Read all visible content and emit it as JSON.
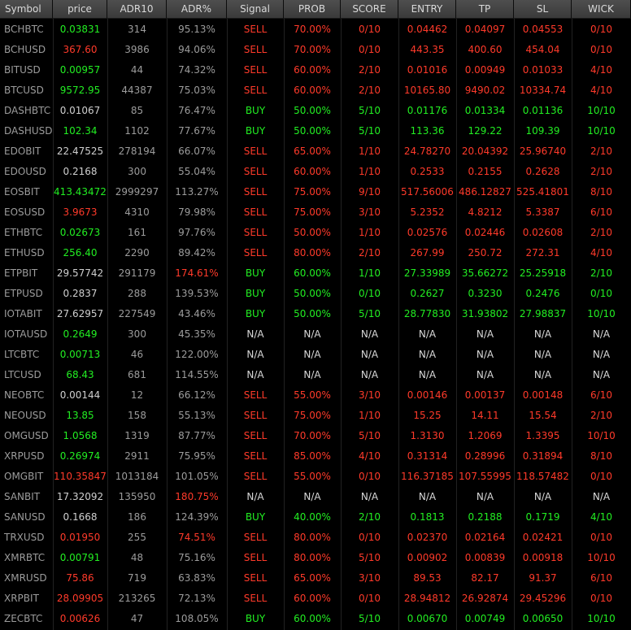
{
  "colors": {
    "neutral": "#cfcfcf",
    "green": "#22ee22",
    "red": "#ff3a2a",
    "na": "#d8d8d8",
    "dim": "#9c9c9c"
  },
  "headers": [
    "Symbol",
    "price",
    "ADR10",
    "ADR%",
    "Signal",
    "PROB",
    "SCORE",
    "ENTRY",
    "TP",
    "SL",
    "WICK"
  ],
  "rows": [
    {
      "symbol": "BCHBTC",
      "price": "0.03831",
      "price_c": "green",
      "adr10": "314",
      "adrp": "95.13%",
      "adrp_c": "dim",
      "signal": "SELL",
      "prob": "70.00%",
      "score": "0/10",
      "entry": "0.04462",
      "tp": "0.04097",
      "sl": "0.04553",
      "wick": "0/10"
    },
    {
      "symbol": "BCHUSD",
      "price": "367.60",
      "price_c": "red",
      "adr10": "3986",
      "adrp": "94.06%",
      "adrp_c": "dim",
      "signal": "SELL",
      "prob": "70.00%",
      "score": "0/10",
      "entry": "443.35",
      "tp": "400.60",
      "sl": "454.04",
      "wick": "0/10"
    },
    {
      "symbol": "BITUSD",
      "price": "0.00957",
      "price_c": "green",
      "adr10": "44",
      "adrp": "74.32%",
      "adrp_c": "dim",
      "signal": "SELL",
      "prob": "60.00%",
      "score": "2/10",
      "entry": "0.01016",
      "tp": "0.00949",
      "sl": "0.01033",
      "wick": "4/10"
    },
    {
      "symbol": "BTCUSD",
      "price": "9572.95",
      "price_c": "green",
      "adr10": "44387",
      "adrp": "75.03%",
      "adrp_c": "dim",
      "signal": "SELL",
      "prob": "60.00%",
      "score": "2/10",
      "entry": "10165.80",
      "tp": "9490.02",
      "sl": "10334.74",
      "wick": "4/10"
    },
    {
      "symbol": "DASHBTC",
      "price": "0.01067",
      "price_c": "neutral",
      "adr10": "85",
      "adrp": "76.47%",
      "adrp_c": "dim",
      "signal": "BUY",
      "prob": "50.00%",
      "score": "5/10",
      "entry": "0.01176",
      "tp": "0.01334",
      "sl": "0.01136",
      "wick": "10/10"
    },
    {
      "symbol": "DASHUSD",
      "price": "102.34",
      "price_c": "green",
      "adr10": "1102",
      "adrp": "77.67%",
      "adrp_c": "dim",
      "signal": "BUY",
      "prob": "50.00%",
      "score": "5/10",
      "entry": "113.36",
      "tp": "129.22",
      "sl": "109.39",
      "wick": "10/10"
    },
    {
      "symbol": "EDOBIT",
      "price": "22.47525",
      "price_c": "neutral",
      "adr10": "278194",
      "adrp": "66.07%",
      "adrp_c": "dim",
      "signal": "SELL",
      "prob": "65.00%",
      "score": "1/10",
      "entry": "24.78270",
      "tp": "20.04392",
      "sl": "25.96740",
      "wick": "2/10"
    },
    {
      "symbol": "EDOUSD",
      "price": "0.2168",
      "price_c": "neutral",
      "adr10": "300",
      "adrp": "55.04%",
      "adrp_c": "dim",
      "signal": "SELL",
      "prob": "60.00%",
      "score": "1/10",
      "entry": "0.2533",
      "tp": "0.2155",
      "sl": "0.2628",
      "wick": "2/10"
    },
    {
      "symbol": "EOSBIT",
      "price": "413.43472",
      "price_c": "green",
      "adr10": "2999297",
      "adrp": "113.27%",
      "adrp_c": "dim",
      "signal": "SELL",
      "prob": "75.00%",
      "score": "9/10",
      "entry": "517.56006",
      "tp": "486.12827",
      "sl": "525.41801",
      "wick": "8/10"
    },
    {
      "symbol": "EOSUSD",
      "price": "3.9673",
      "price_c": "red",
      "adr10": "4310",
      "adrp": "79.98%",
      "adrp_c": "dim",
      "signal": "SELL",
      "prob": "75.00%",
      "score": "3/10",
      "entry": "5.2352",
      "tp": "4.8212",
      "sl": "5.3387",
      "wick": "6/10"
    },
    {
      "symbol": "ETHBTC",
      "price": "0.02673",
      "price_c": "green",
      "adr10": "161",
      "adrp": "97.76%",
      "adrp_c": "dim",
      "signal": "SELL",
      "prob": "50.00%",
      "score": "1/10",
      "entry": "0.02576",
      "tp": "0.02446",
      "sl": "0.02608",
      "wick": "2/10"
    },
    {
      "symbol": "ETHUSD",
      "price": "256.40",
      "price_c": "green",
      "adr10": "2290",
      "adrp": "89.42%",
      "adrp_c": "dim",
      "signal": "SELL",
      "prob": "80.00%",
      "score": "2/10",
      "entry": "267.99",
      "tp": "250.72",
      "sl": "272.31",
      "wick": "4/10"
    },
    {
      "symbol": "ETPBIT",
      "price": "29.57742",
      "price_c": "neutral",
      "adr10": "291179",
      "adrp": "174.61%",
      "adrp_c": "red",
      "signal": "BUY",
      "prob": "60.00%",
      "score": "1/10",
      "entry": "27.33989",
      "tp": "35.66272",
      "sl": "25.25918",
      "wick": "2/10"
    },
    {
      "symbol": "ETPUSD",
      "price": "0.2837",
      "price_c": "neutral",
      "adr10": "288",
      "adrp": "139.53%",
      "adrp_c": "dim",
      "signal": "BUY",
      "prob": "50.00%",
      "score": "0/10",
      "entry": "0.2627",
      "tp": "0.3230",
      "sl": "0.2476",
      "wick": "0/10"
    },
    {
      "symbol": "IOTABIT",
      "price": "27.62957",
      "price_c": "neutral",
      "adr10": "227549",
      "adrp": "43.46%",
      "adrp_c": "dim",
      "signal": "BUY",
      "prob": "50.00%",
      "score": "5/10",
      "entry": "28.77830",
      "tp": "31.93802",
      "sl": "27.98837",
      "wick": "10/10"
    },
    {
      "symbol": "IOTAUSD",
      "price": "0.2649",
      "price_c": "green",
      "adr10": "300",
      "adrp": "45.35%",
      "adrp_c": "dim",
      "signal": "N/A",
      "prob": "N/A",
      "score": "N/A",
      "entry": "N/A",
      "tp": "N/A",
      "sl": "N/A",
      "wick": "N/A"
    },
    {
      "symbol": "LTCBTC",
      "price": "0.00713",
      "price_c": "green",
      "adr10": "46",
      "adrp": "122.00%",
      "adrp_c": "dim",
      "signal": "N/A",
      "prob": "N/A",
      "score": "N/A",
      "entry": "N/A",
      "tp": "N/A",
      "sl": "N/A",
      "wick": "N/A"
    },
    {
      "symbol": "LTCUSD",
      "price": "68.43",
      "price_c": "green",
      "adr10": "681",
      "adrp": "114.55%",
      "adrp_c": "dim",
      "signal": "N/A",
      "prob": "N/A",
      "score": "N/A",
      "entry": "N/A",
      "tp": "N/A",
      "sl": "N/A",
      "wick": "N/A"
    },
    {
      "symbol": "NEOBTC",
      "price": "0.00144",
      "price_c": "neutral",
      "adr10": "12",
      "adrp": "66.12%",
      "adrp_c": "dim",
      "signal": "SELL",
      "prob": "55.00%",
      "score": "3/10",
      "entry": "0.00146",
      "tp": "0.00137",
      "sl": "0.00148",
      "wick": "6/10"
    },
    {
      "symbol": "NEOUSD",
      "price": "13.85",
      "price_c": "green",
      "adr10": "158",
      "adrp": "55.13%",
      "adrp_c": "dim",
      "signal": "SELL",
      "prob": "75.00%",
      "score": "1/10",
      "entry": "15.25",
      "tp": "14.11",
      "sl": "15.54",
      "wick": "2/10"
    },
    {
      "symbol": "OMGUSD",
      "price": "1.0568",
      "price_c": "green",
      "adr10": "1319",
      "adrp": "87.77%",
      "adrp_c": "dim",
      "signal": "SELL",
      "prob": "70.00%",
      "score": "5/10",
      "entry": "1.3130",
      "tp": "1.2069",
      "sl": "1.3395",
      "wick": "10/10"
    },
    {
      "symbol": "XRPUSD",
      "price": "0.26974",
      "price_c": "green",
      "adr10": "2911",
      "adrp": "75.95%",
      "adrp_c": "dim",
      "signal": "SELL",
      "prob": "85.00%",
      "score": "4/10",
      "entry": "0.31314",
      "tp": "0.28996",
      "sl": "0.31894",
      "wick": "8/10"
    },
    {
      "symbol": "OMGBIT",
      "price": "110.35847",
      "price_c": "red",
      "adr10": "1013184",
      "adrp": "101.05%",
      "adrp_c": "dim",
      "signal": "SELL",
      "prob": "55.00%",
      "score": "0/10",
      "entry": "116.37185",
      "tp": "107.55995",
      "sl": "118.57482",
      "wick": "0/10"
    },
    {
      "symbol": "SANBIT",
      "price": "17.32092",
      "price_c": "neutral",
      "adr10": "135950",
      "adrp": "180.75%",
      "adrp_c": "red",
      "signal": "N/A",
      "prob": "N/A",
      "score": "N/A",
      "entry": "N/A",
      "tp": "N/A",
      "sl": "N/A",
      "wick": "N/A"
    },
    {
      "symbol": "SANUSD",
      "price": "0.1668",
      "price_c": "neutral",
      "adr10": "186",
      "adrp": "124.39%",
      "adrp_c": "dim",
      "signal": "BUY",
      "prob": "40.00%",
      "score": "2/10",
      "entry": "0.1813",
      "tp": "0.2188",
      "sl": "0.1719",
      "wick": "4/10"
    },
    {
      "symbol": "TRXUSD",
      "price": "0.01950",
      "price_c": "red",
      "adr10": "255",
      "adrp": "74.51%",
      "adrp_c": "red",
      "signal": "SELL",
      "prob": "80.00%",
      "score": "0/10",
      "entry": "0.02370",
      "tp": "0.02164",
      "sl": "0.02421",
      "wick": "0/10"
    },
    {
      "symbol": "XMRBTC",
      "price": "0.00791",
      "price_c": "green",
      "adr10": "48",
      "adrp": "75.16%",
      "adrp_c": "dim",
      "signal": "SELL",
      "prob": "80.00%",
      "score": "5/10",
      "entry": "0.00902",
      "tp": "0.00839",
      "sl": "0.00918",
      "wick": "10/10"
    },
    {
      "symbol": "XMRUSD",
      "price": "75.86",
      "price_c": "red",
      "adr10": "719",
      "adrp": "63.83%",
      "adrp_c": "dim",
      "signal": "SELL",
      "prob": "65.00%",
      "score": "3/10",
      "entry": "89.53",
      "tp": "82.17",
      "sl": "91.37",
      "wick": "6/10"
    },
    {
      "symbol": "XRPBIT",
      "price": "28.09905",
      "price_c": "red",
      "adr10": "213265",
      "adrp": "72.13%",
      "adrp_c": "dim",
      "signal": "SELL",
      "prob": "60.00%",
      "score": "0/10",
      "entry": "28.94812",
      "tp": "26.92874",
      "sl": "29.45296",
      "wick": "0/10"
    },
    {
      "symbol": "ZECBTC",
      "price": "0.00626",
      "price_c": "red",
      "adr10": "47",
      "adrp": "108.05%",
      "adrp_c": "dim",
      "signal": "BUY",
      "prob": "60.00%",
      "score": "5/10",
      "entry": "0.00670",
      "tp": "0.00749",
      "sl": "0.00650",
      "wick": "10/10"
    }
  ]
}
